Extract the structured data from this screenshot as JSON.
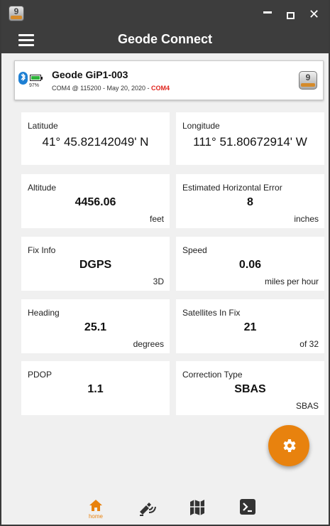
{
  "app": {
    "title": "Geode Connect",
    "icon_text": "9"
  },
  "device": {
    "name": "Geode GiP1-003",
    "battery_pct": "97%",
    "battery_level": 0.97,
    "connection": "COM4 @ 115200 - May 20, 2020 - ",
    "port": "COM4",
    "logo_text": "9"
  },
  "tiles": {
    "latitude": {
      "label": "Latitude",
      "value": "41° 45.82142049' N"
    },
    "longitude": {
      "label": "Longitude",
      "value": "111° 51.80672914' W"
    },
    "altitude": {
      "label": "Altitude",
      "value": "4456.06",
      "unit": "feet"
    },
    "ehe": {
      "label": "Estimated Horizontal Error",
      "value": "8",
      "unit": "inches"
    },
    "fix": {
      "label": "Fix Info",
      "value": "DGPS",
      "unit": "3D"
    },
    "speed": {
      "label": "Speed",
      "value": "0.06",
      "unit": "miles per hour"
    },
    "heading": {
      "label": "Heading",
      "value": "25.1",
      "unit": "degrees"
    },
    "satellites": {
      "label": "Satellites In Fix",
      "value": "21",
      "unit": "of 32"
    },
    "pdop": {
      "label": "PDOP",
      "value": "1.1"
    },
    "correction": {
      "label": "Correction Type",
      "value": "SBAS",
      "unit": "SBAS"
    }
  },
  "nav": {
    "home_label": "home",
    "items": [
      "home-icon",
      "satellite-icon",
      "map-icon",
      "terminal-icon"
    ]
  },
  "colors": {
    "accent": "#e8820e",
    "titlebar": "#3d3d3d",
    "port_red": "#e0231c",
    "bluetooth": "#1d7fd3"
  }
}
